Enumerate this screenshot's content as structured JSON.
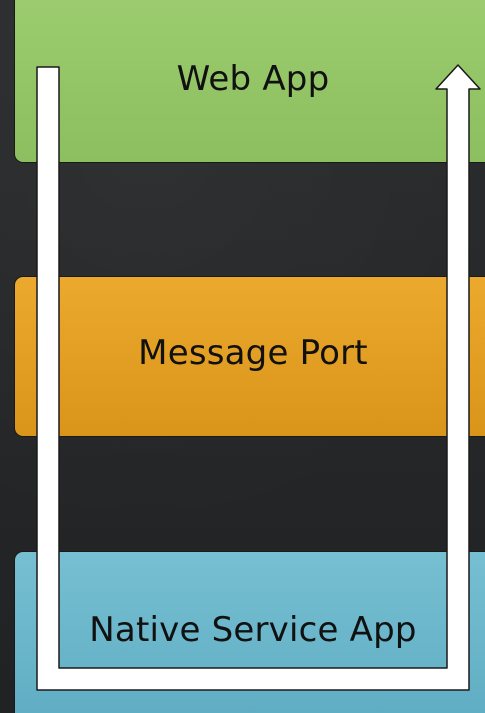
{
  "diagram": {
    "layers": [
      {
        "id": "web-app",
        "label": "Web App",
        "color": "#8cbf5f"
      },
      {
        "id": "message-port",
        "label": "Message Port",
        "color": "#e3a021"
      },
      {
        "id": "native-service-app",
        "label": "Native Service App",
        "color": "#68b4c9"
      }
    ],
    "arrow": {
      "color": "#ffffff",
      "outline": "#1a1a1a"
    }
  }
}
